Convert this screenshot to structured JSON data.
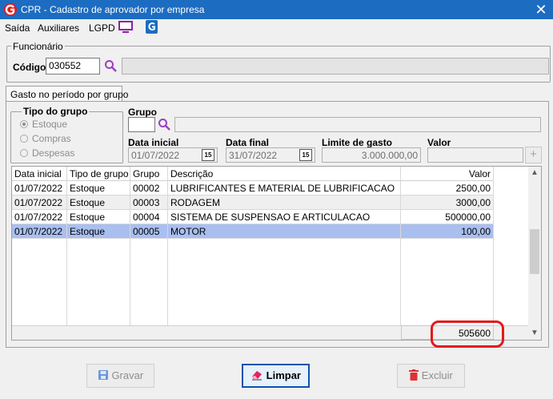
{
  "window": {
    "title": "CPR - Cadastro de aprovador por empresa",
    "close": "✕"
  },
  "menu": {
    "items": [
      "Saída",
      "Auxiliares",
      "LGPD"
    ]
  },
  "funcionario": {
    "legend": "Funcionário",
    "codigo_label": "Código",
    "codigo_value": "030552",
    "name_value": ""
  },
  "tabs": [
    {
      "label": "Gasto no período por grupo"
    }
  ],
  "tipo_grupo": {
    "legend": "Tipo do grupo",
    "options": [
      "Estoque",
      "Compras",
      "Despesas"
    ],
    "selected": "Estoque"
  },
  "grupo": {
    "label": "Grupo",
    "value": "",
    "desc": ""
  },
  "filters": {
    "data_inicial_label": "Data inicial",
    "data_inicial_value": "01/07/2022",
    "data_final_label": "Data final",
    "data_final_value": "31/07/2022",
    "limite_label": "Limite de gasto",
    "limite_value": "3.000.000,00",
    "valor_label": "Valor",
    "valor_value": "",
    "cal_glyph": "15",
    "add_glyph": "+"
  },
  "table": {
    "columns": [
      "Data inicial",
      "Tipo de grupo",
      "Grupo",
      "Descrição",
      "Valor"
    ],
    "rows": [
      [
        "01/07/2022",
        "Estoque",
        "00002",
        "LUBRIFICANTES E MATERIAL DE LUBRIFICACAO",
        "2500,00"
      ],
      [
        "01/07/2022",
        "Estoque",
        "00003",
        "RODAGEM",
        "3000,00"
      ],
      [
        "01/07/2022",
        "Estoque",
        "00004",
        "SISTEMA DE SUSPENSAO E ARTICULACAO",
        "500000,00"
      ],
      [
        "01/07/2022",
        "Estoque",
        "00005",
        "MOTOR",
        "100,00"
      ]
    ],
    "selected_row": 3,
    "total": "505600"
  },
  "buttons": {
    "gravar": "Gravar",
    "limpar": "Limpar",
    "excluir": "Excluir"
  },
  "colors": {
    "titlebar": "#1c6cc2",
    "selection": "#a9bff0",
    "highlight": "#e31a1a"
  }
}
